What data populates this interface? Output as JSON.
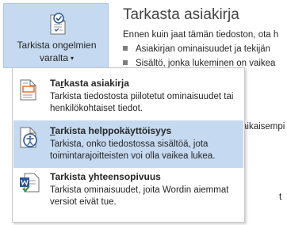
{
  "inspect_button": {
    "label_line1": "Tarkista ongelmien",
    "label_line2": "varalta",
    "caret": "▾",
    "icon": "document-check-icon"
  },
  "panel": {
    "heading": "Tarkasta asiakirja",
    "intro": "Ennen kuin jaat tämän tiedoston, ota h",
    "bullets": [
      "Asiakirjan ominaisuudet ja tekijän",
      "Sisältö, jonka lukeminen on vaikea"
    ],
    "fragment_mid": "aikaisempi",
    "fragment_bottom": "t"
  },
  "menu": {
    "items": [
      {
        "title_pre": "Ta",
        "title_u": "r",
        "title_post": "kasta asiakirja",
        "description": "Tarkista tiedostosta piilotetut ominaisuudet tai henkilökohtaiset tiedot.",
        "icon": "inspect-document-icon"
      },
      {
        "title_pre": "",
        "title_u": "T",
        "title_post": "arkista helppokäyttöisyys",
        "description": "Tarkista, onko tiedostossa sisältöä, jota toimintarajoitteisten voi olla vaikea lukea.",
        "icon": "accessibility-check-icon"
      },
      {
        "title_pre": "Tarkista ",
        "title_u": "y",
        "title_post": "hteensopivuus",
        "description": "Tarkista ominaisuudet, joita Wordin aiemmat versiot eivät tue.",
        "icon": "compatibility-check-icon"
      }
    ]
  },
  "colors": {
    "highlight": "#c5daf0",
    "accent_blue": "#2b579a",
    "icon_orange": "#e8702a"
  }
}
